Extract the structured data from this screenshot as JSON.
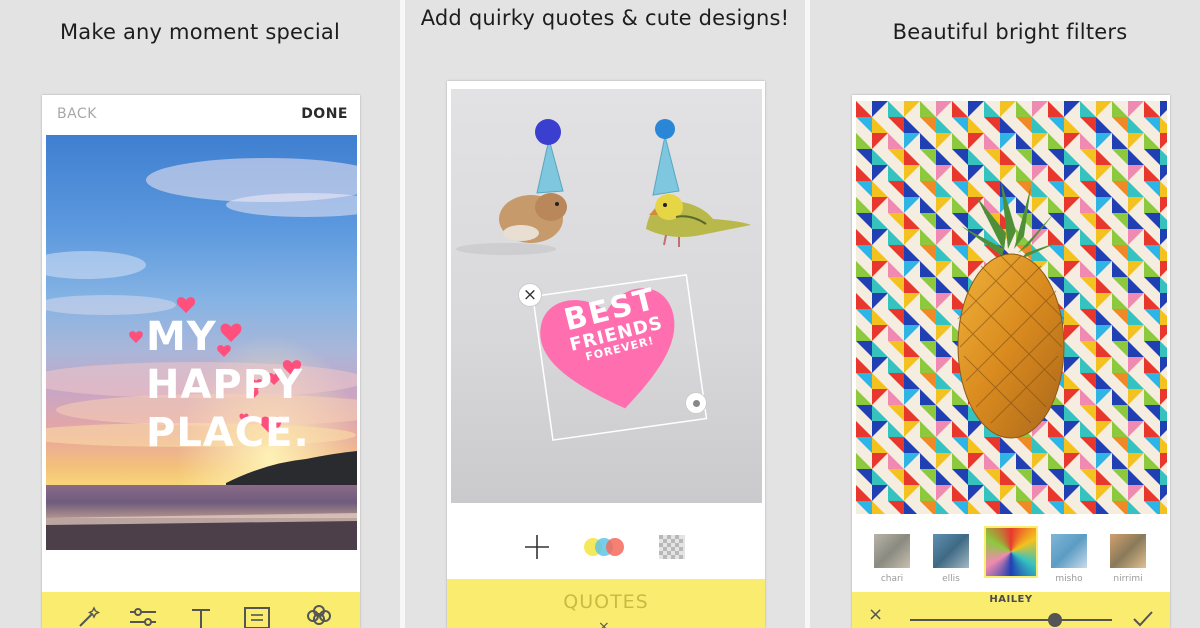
{
  "panels": [
    {
      "caption": "Make any moment special",
      "topbar": {
        "back_label": "BACK",
        "done_label": "DONE"
      },
      "sticker_lines": [
        "MY",
        "HAPPY",
        "PLACE."
      ],
      "toolbar_icons": [
        "magic-wand-icon",
        "sliders-icon",
        "text-icon",
        "frame-icon",
        "sticker-icon"
      ]
    },
    {
      "caption": "Add quirky quotes & cute designs!",
      "sticker_lines": [
        "BEST",
        "FRIENDS",
        "FOREVER!"
      ],
      "actions": [
        "add-icon",
        "color-circles-icon",
        "transparency-icon"
      ],
      "bottom_label": "QUOTES"
    },
    {
      "caption": "Beautiful bright filters",
      "filters": [
        {
          "name": "chari",
          "selected": false
        },
        {
          "name": "ellis",
          "selected": false
        },
        {
          "name": "hailey",
          "selected": true
        },
        {
          "name": "misho",
          "selected": false
        },
        {
          "name": "nirrimi",
          "selected": false
        }
      ],
      "active_filter_label": "HAILEY",
      "intensity": 0.72
    }
  ],
  "colors": {
    "accent_yellow": "#f9ec6e",
    "heart_pink": "#ff6fa8",
    "text_dark": "#1d1d1d"
  }
}
